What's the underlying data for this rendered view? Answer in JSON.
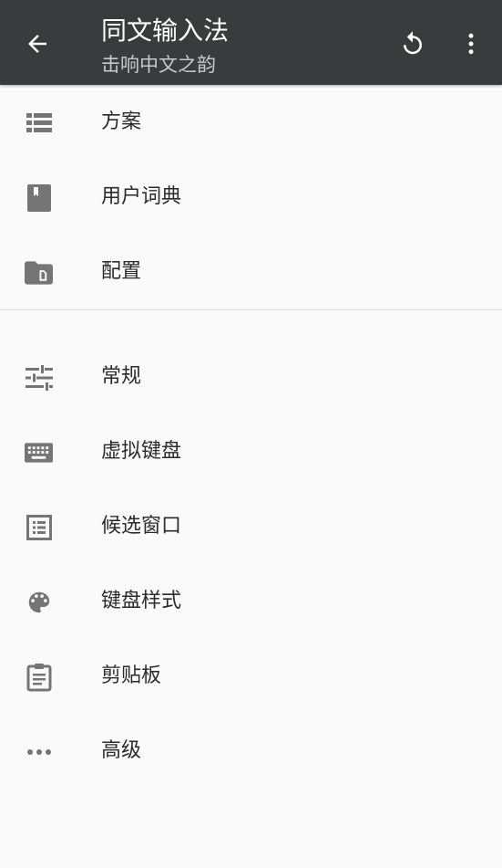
{
  "toolbar": {
    "title": "同文输入法",
    "subtitle": "击响中文之韵",
    "back_icon": "arrow-back-icon",
    "refresh_icon": "refresh-icon",
    "more_icon": "more-vert-icon"
  },
  "colors": {
    "toolbar_bg": "#3a3b3d",
    "page_bg": "#fafafa",
    "icon_gray": "#757575",
    "label_text": "#2b2b2b"
  },
  "groups": [
    {
      "items": [
        {
          "label": "方案",
          "icon": "list-icon"
        },
        {
          "label": "用户词典",
          "icon": "book-icon"
        },
        {
          "label": "配置",
          "icon": "folder-icon"
        }
      ]
    },
    {
      "items": [
        {
          "label": "常规",
          "icon": "tune-icon"
        },
        {
          "label": "虚拟键盘",
          "icon": "keyboard-icon"
        },
        {
          "label": "候选窗口",
          "icon": "list-alt-icon"
        },
        {
          "label": "键盘样式",
          "icon": "palette-icon"
        },
        {
          "label": "剪贴板",
          "icon": "clipboard-icon"
        },
        {
          "label": "高级",
          "icon": "more-horiz-icon"
        }
      ]
    }
  ]
}
